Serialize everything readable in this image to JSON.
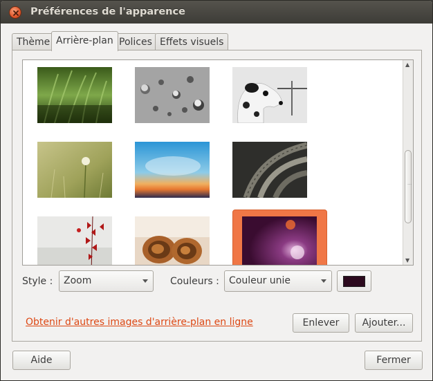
{
  "window": {
    "title": "Préférences de l'apparence"
  },
  "tabs": [
    {
      "label": "Thème"
    },
    {
      "label": "Arrière-plan"
    },
    {
      "label": "Polices"
    },
    {
      "label": "Effets visuels"
    }
  ],
  "active_tab": "Arrière-plan",
  "background": {
    "style_label": "Style :",
    "style_value": "Zoom",
    "colors_label": "Couleurs :",
    "colors_value": "Couleur unie",
    "color_swatch": "#2c0a1e",
    "online_link": "Obtenir d'autres images d'arrière-plan en ligne",
    "remove_label": "Enlever",
    "add_label": "Ajouter...",
    "selected_index": 8
  },
  "footer": {
    "help_label": "Aide",
    "close_label": "Fermer"
  },
  "colors": {
    "accent": "#f07746",
    "link": "#dd4814",
    "titlebar": "#3d3c37"
  }
}
